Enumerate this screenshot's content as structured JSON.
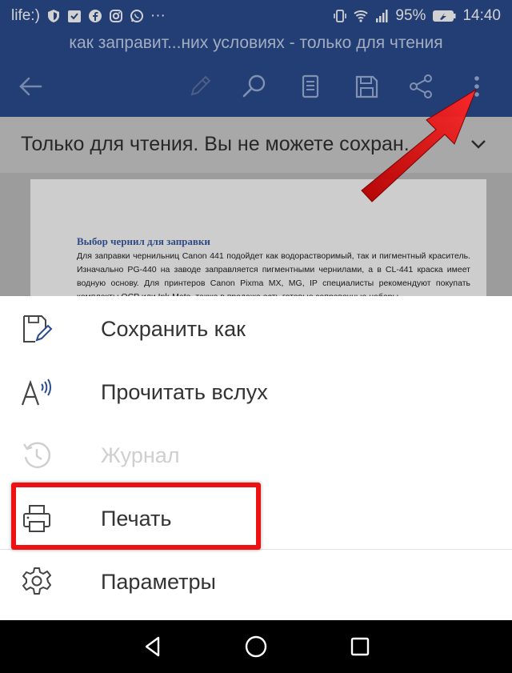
{
  "status_bar": {
    "carrier": "life:)",
    "battery": "95%",
    "time": "14:40",
    "more_dots": "···"
  },
  "header": {
    "document_title": "как заправит...них условиях - только для чтения"
  },
  "toolbar": {
    "icons": [
      "back-arrow-icon",
      "edit-pencil-icon",
      "search-icon",
      "reading-view-icon",
      "save-icon",
      "share-icon",
      "more-vertical-icon"
    ]
  },
  "banner": {
    "text": "Только для чтения. Вы не можете сохран.",
    "icon": "chevron-down-icon"
  },
  "document": {
    "heading": "Выбор чернил для заправки",
    "paragraph": "Для заправки чернильниц Canon 441 подойдет как водорастворимый, так и пигментный краситель. Изначально PG-440 на заводе заправляется пигментными чернилами, а в CL-441 краска имеет водную основу. Для принтеров Canon Pixma MX, MG, IP специалисты рекомендуют покупать комплекты OCP или Ink-Mate, также в продаже есть готовые заправочные наборы."
  },
  "menu": {
    "items": [
      {
        "label": "Сохранить как",
        "icon": "save-as-icon",
        "enabled": true
      },
      {
        "label": "Прочитать вслух",
        "icon": "read-aloud-icon",
        "enabled": true
      },
      {
        "label": "Журнал",
        "icon": "history-icon",
        "enabled": false
      },
      {
        "label": "Печать",
        "icon": "printer-icon",
        "enabled": true
      },
      {
        "label": "Параметры",
        "icon": "gear-icon",
        "enabled": true
      }
    ]
  },
  "colors": {
    "app_blue": "#2a4c8e",
    "highlight_red": "#ee1111",
    "banner_gray": "#cdcdcd"
  },
  "navbar": {
    "icons": [
      "nav-back-icon",
      "nav-home-icon",
      "nav-recents-icon"
    ]
  }
}
